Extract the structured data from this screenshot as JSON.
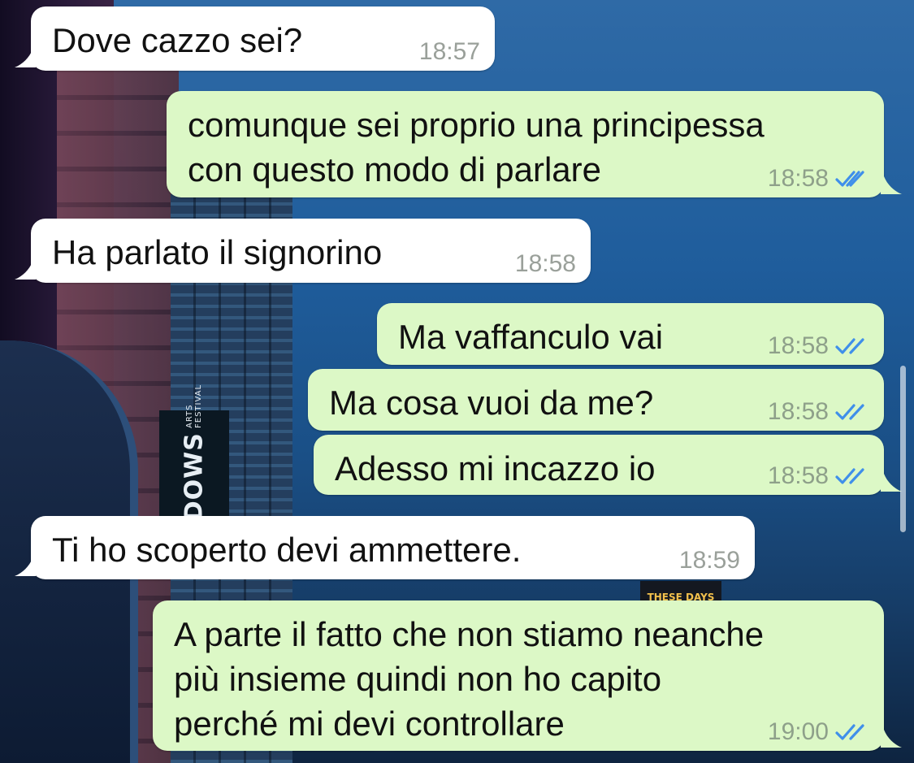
{
  "background": {
    "wallpaper": "city-street-night-photo",
    "sign_text": "EADOWS",
    "sign_subtext": "ARTS FESTIVAL",
    "marquee_text": "THESE DAYS"
  },
  "colors": {
    "incoming_bubble": "#ffffff",
    "outgoing_bubble": "#dcf8c6",
    "read_ticks": "#3f8fea"
  },
  "messages": [
    {
      "direction": "incoming",
      "text": "Dove cazzo sei?",
      "time": "18:57"
    },
    {
      "direction": "outgoing",
      "text": "comunque sei proprio una principessa\ncon questo modo di parlare",
      "time": "18:58",
      "status": "read"
    },
    {
      "direction": "incoming",
      "text": "Ha parlato il signorino",
      "time": "18:58"
    },
    {
      "direction": "outgoing",
      "text": "Ma vaffanculo vai",
      "time": "18:58",
      "status": "read"
    },
    {
      "direction": "outgoing",
      "text": "Ma cosa vuoi da me?",
      "time": "18:58",
      "status": "read"
    },
    {
      "direction": "outgoing",
      "text": "Adesso mi incazzo io",
      "time": "18:58",
      "status": "read"
    },
    {
      "direction": "incoming",
      "text": "Ti ho scoperto devi ammettere.",
      "time": "18:59"
    },
    {
      "direction": "outgoing",
      "text": "A parte il fatto che non stiamo neanche\npiù insieme quindi non ho capito\nperché mi devi controllare",
      "time": "19:00",
      "status": "read"
    }
  ]
}
